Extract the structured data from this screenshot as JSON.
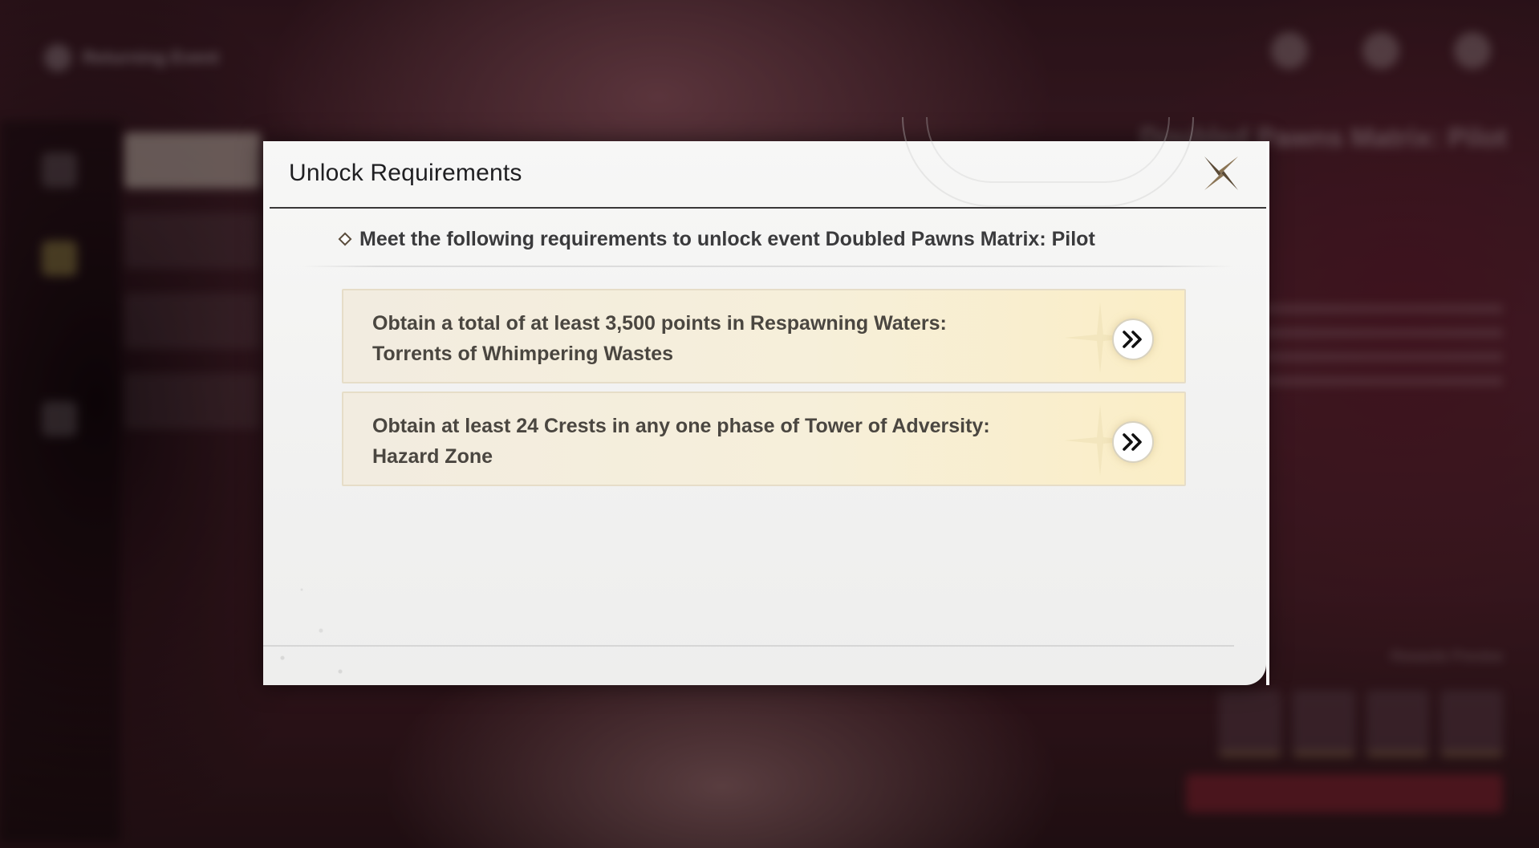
{
  "background": {
    "back_label": "Returning Event",
    "title": "Doubled Pawns Matrix: Pilot",
    "rewards_label": "Rewards Preview"
  },
  "dialog": {
    "title": "Unlock Requirements",
    "close_icon": "close-cross-icon",
    "intro": "Meet the following requirements to unlock event Doubled Pawns Matrix: Pilot",
    "requirements": [
      {
        "line1": "Obtain a total of at least 3,500 points in Respawning Waters:",
        "line2": "Torrents of Whimpering Wastes",
        "go_icon": "double-chevron-right-icon"
      },
      {
        "line1": "Obtain at least 24 Crests in any one phase of Tower of Adversity:",
        "line2": "Hazard Zone",
        "go_icon": "double-chevron-right-icon"
      }
    ]
  },
  "colors": {
    "accent_gold": "#fbeec6",
    "dialog_bg": "#f7f7f6",
    "title_text": "#1f1f22"
  }
}
